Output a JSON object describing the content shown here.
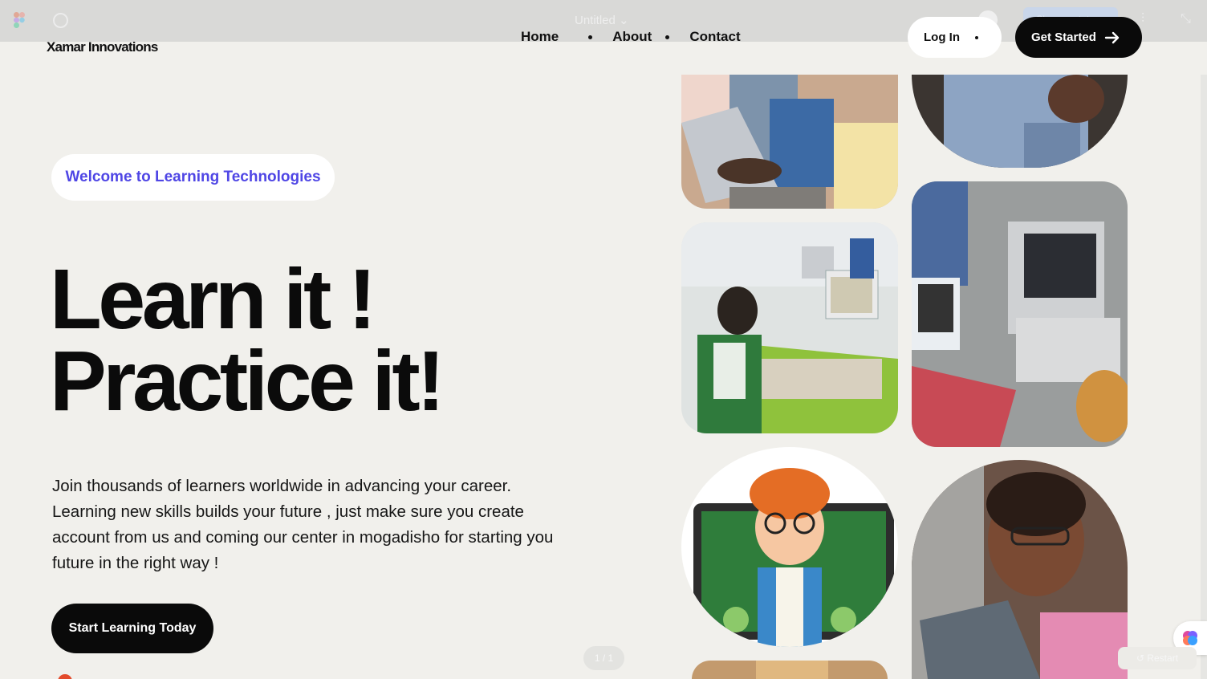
{
  "figma_toolbar": {
    "file_title": "Untitled",
    "share_label": "Share prototype",
    "pager": "1 / 1",
    "restart_label": "Restart"
  },
  "site": {
    "brand": "Xamar Innovations",
    "nav": [
      {
        "label": "Home"
      },
      {
        "label": "About"
      },
      {
        "label": "Contact"
      }
    ],
    "login_label": "Log In",
    "cta_label": "Get Started"
  },
  "hero": {
    "badge": "Welcome to Learning Technologies",
    "headline_line1": "Learn it !",
    "headline_line2": "Practice it!",
    "description": "Join thousands of learners worldwide in advancing your career. Learning new skills builds your future , just make sure you create account from us and coming our center in mogadisho for starting you future in the right way !",
    "button_label": "Start Learning Today"
  },
  "colors": {
    "background": "#f1f0ec",
    "accent": "#4f46e5",
    "button_dark": "#0a0a0a"
  },
  "images": [
    {
      "name": "student-laptop-photo"
    },
    {
      "name": "student-smiling-photo"
    },
    {
      "name": "computer-lab-photo"
    },
    {
      "name": "tablet-laptop-study-photo"
    },
    {
      "name": "cartoon-scientist-boy-illustration"
    },
    {
      "name": "boy-with-tablet-photo"
    },
    {
      "name": "desk-photo"
    }
  ]
}
